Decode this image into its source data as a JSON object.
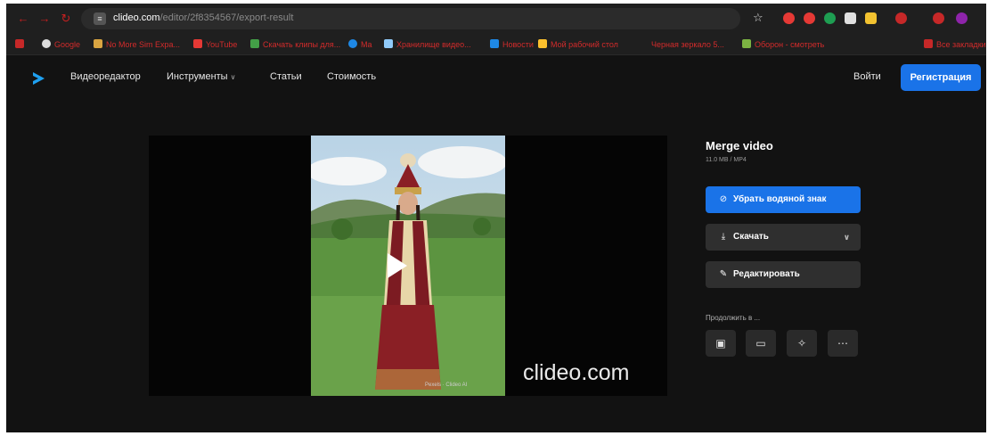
{
  "browser": {
    "url_domain": "clideo.com",
    "url_path": "/editor/2f8354567/export-result",
    "bookmarks": [
      "Google",
      "No More Sim Expa...",
      "YouTube",
      "Скачать клипы для...",
      "Ma",
      "Хранилище видео...",
      "Новости",
      "Мой рабочий стол",
      "Черная зеркало 5...",
      "Оборон - смотреть",
      "Все закладки"
    ]
  },
  "header": {
    "nav": [
      "Видеоредактор",
      "Инструменты",
      "Статьи",
      "Стоимость"
    ],
    "login": "Войти",
    "signup": "Регистрация"
  },
  "player": {
    "watermark": "clideo.com",
    "small_mark": "Pexels · Clideo AI"
  },
  "panel": {
    "title": "Merge video",
    "meta": "11.0 MB  /  MP4",
    "remove_watermark": "Убрать водяной знак",
    "download": "Скачать",
    "edit": "Редактировать",
    "continue_label": "Продолжить в ..."
  },
  "colors": {
    "accent": "#1a73e8",
    "background": "#121212"
  }
}
